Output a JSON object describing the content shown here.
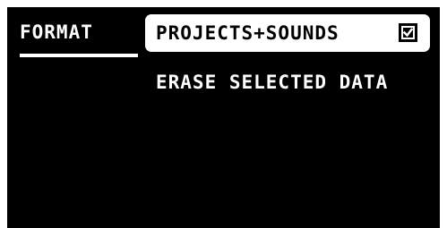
{
  "screen": {
    "tab": {
      "label": "FORMAT",
      "active": true
    },
    "option": {
      "label": "PROJECTS+SOUNDS",
      "checked": true,
      "icon": "checkbox-checked-icon"
    },
    "description": "ERASE SELECTED DATA"
  },
  "colors": {
    "background": "#000000",
    "foreground": "#ffffff",
    "frame": "#ffffff"
  }
}
